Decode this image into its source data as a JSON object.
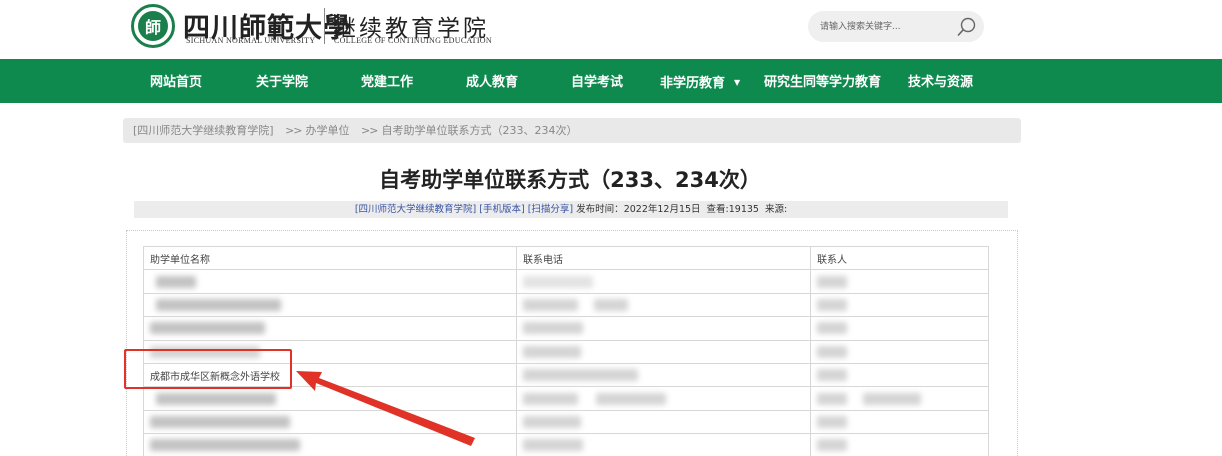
{
  "header": {
    "logo_seal_char": "師",
    "logo_cn": "四川師範大學",
    "logo_en": "SICHUAN NORMAL UNIVERSITY",
    "college_cn": "继续教育学院",
    "college_en": "COLLEGE OF CONTINUING EDUCATION"
  },
  "search": {
    "placeholder": "请输入搜索关键字...",
    "value": ""
  },
  "nav": {
    "items": [
      {
        "label": "网站首页"
      },
      {
        "label": "关于学院"
      },
      {
        "label": "党建工作"
      },
      {
        "label": "成人教育"
      },
      {
        "label": "自学考试"
      },
      {
        "label": "非学历教育",
        "caret": "▼"
      },
      {
        "label": "研究生同等学力教育"
      },
      {
        "label": "技术与资源"
      }
    ]
  },
  "breadcrumb": {
    "root": "[四川师范大学继续教育学院]",
    "sep": ">>",
    "level1": "办学单位",
    "current": "自考助学单位联系方式（233、234次）"
  },
  "article": {
    "title": "自考助学单位联系方式（233、234次）",
    "meta": {
      "source_link": "[四川师范大学继续教育学院]",
      "mobile_link": "[手机版本]",
      "share_link": "[扫描分享]",
      "published_label": "发布时间：",
      "published_value": "2022年12月15日",
      "views_label": "查看:",
      "views_value": "19135",
      "source_label": "来源:"
    }
  },
  "table": {
    "headers": [
      "助学单位名称",
      "联系电话",
      "联系人"
    ],
    "highlighted_row_name": "成都市成华区新概念外语学校"
  },
  "colors": {
    "nav_green": "#0f8a4f",
    "logo_green": "#1b7f4b",
    "highlight_red": "#e03226",
    "link_blue": "#3a55a5"
  }
}
